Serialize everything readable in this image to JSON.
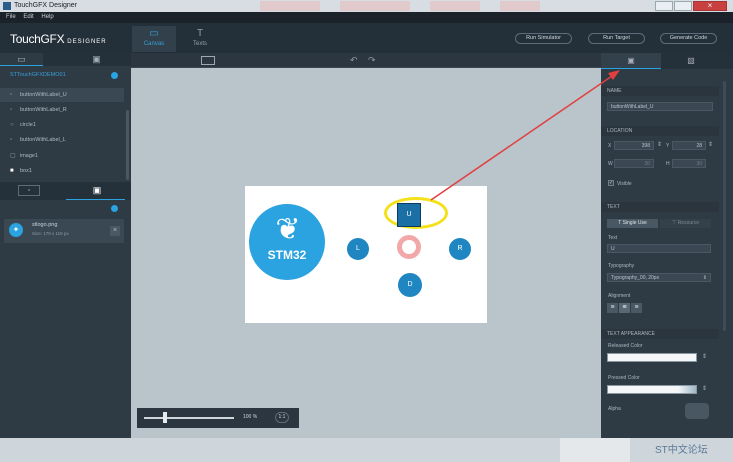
{
  "window": {
    "title": "TouchGFX Designer",
    "close_glyph": "×"
  },
  "menu": [
    "File",
    "Edit",
    "Help"
  ],
  "toolbar": {
    "logo": "TouchGFX",
    "logo_sub": "DESIGNER",
    "tabs": [
      {
        "label": "Canvas",
        "icon": "canvas-icon"
      },
      {
        "label": "Texts",
        "icon": "texts-icon"
      }
    ],
    "buttons": [
      "Run Simulator",
      "Run Target",
      "Generate Code"
    ]
  },
  "left_panel": {
    "screen_name": "STTouchGFXDEMO01",
    "tree": [
      {
        "label": "buttonWithLabel_U",
        "selected": true
      },
      {
        "label": "buttonWithLabel_R",
        "selected": false
      },
      {
        "label": "circle1",
        "selected": false
      },
      {
        "label": "buttonWithLabel_L",
        "selected": false
      },
      {
        "label": "image1",
        "selected": false
      },
      {
        "label": "box1",
        "selected": false
      }
    ],
    "asset": {
      "name": "stlogo.png",
      "size": "Size: 179 x 119 px"
    }
  },
  "canvas": {
    "logo_text": "STM32",
    "buttons": {
      "up": "U",
      "left": "L",
      "right": "R",
      "down": "D"
    },
    "zoom": "100 %",
    "fit": "1:1"
  },
  "right_panel": {
    "name_header": "NAME",
    "name_value": "buttonWithLabel_U",
    "location_header": "LOCATION",
    "loc_x": "398",
    "loc_y": "28",
    "loc_w": "30",
    "loc_h": "30",
    "visible": "Visible",
    "text_header": "TEXT",
    "single_use": "Single Use",
    "resource": "Resource",
    "text_label": "Text",
    "text_value": "U",
    "typo_label": "Typography",
    "typo_value": "Typography_00, 20px",
    "align_label": "Alignment",
    "appearance_header": "TEXT APPEARANCE",
    "released_label": "Released Color",
    "pressed_label": "Pressed Color",
    "alpha_label": "Alpha"
  },
  "watermark": "ST中文论坛",
  "colors": {
    "accent": "#1f86c1",
    "highlight": "#f5e11b",
    "arrow": "#e04040"
  }
}
